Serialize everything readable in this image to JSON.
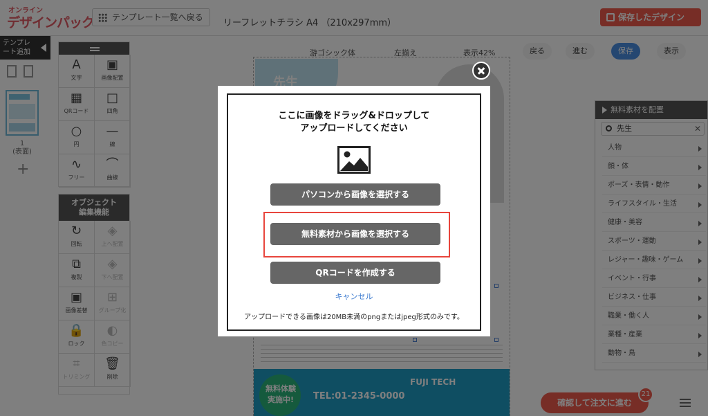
{
  "header": {
    "logo_line1": "オンライン",
    "logo_line2": "デザインパック",
    "template_back": "テンプレート一覧へ戻る",
    "doc_title": "リーフレットチラシ A4 （210x297mm）",
    "save_design": "保存したデザイン"
  },
  "left_panel": {
    "template_add": "テンプレート追加",
    "page_label_line1": "1",
    "page_label_line2": "(表面)",
    "add_page": "+"
  },
  "tools": [
    {
      "label": "文字",
      "glyph": "A",
      "icon": "text-icon"
    },
    {
      "label": "画像配置",
      "glyph": "▣",
      "icon": "image-icon"
    },
    {
      "label": "QRコード",
      "glyph": "▦",
      "icon": "qr-icon"
    },
    {
      "label": "四角",
      "glyph": "□",
      "icon": "square-icon"
    },
    {
      "label": "円",
      "glyph": "○",
      "icon": "circle-icon"
    },
    {
      "label": "線",
      "glyph": "—",
      "icon": "line-icon"
    },
    {
      "label": "フリー",
      "glyph": "∿",
      "icon": "free-draw-icon"
    },
    {
      "label": "曲線",
      "glyph": "⌒",
      "icon": "curve-icon"
    }
  ],
  "edit_panel": {
    "title_line1": "オブジェクト",
    "title_line2": "編集機能",
    "items": [
      {
        "label": "回転",
        "glyph": "↻",
        "dim": false
      },
      {
        "label": "上へ配置",
        "glyph": "◈",
        "dim": true
      },
      {
        "label": "複製",
        "glyph": "⧉",
        "dim": false
      },
      {
        "label": "下へ配置",
        "glyph": "◈",
        "dim": true
      },
      {
        "label": "画像差替",
        "glyph": "▣",
        "dim": false
      },
      {
        "label": "グループ化",
        "glyph": "⊞",
        "dim": true
      },
      {
        "label": "ロック",
        "glyph": "🔒",
        "dim": false
      },
      {
        "label": "色コピー",
        "glyph": "◐",
        "dim": true
      },
      {
        "label": "トリミング",
        "glyph": "⌗",
        "dim": true
      },
      {
        "label": "削除",
        "glyph": "🗑",
        "dim": false
      }
    ]
  },
  "canvas_toolbar": {
    "font_select": "游ゴシック体",
    "align_select": "左揃え",
    "zoom": "表示42%",
    "back_btn": "戻る",
    "forward_btn": "進む",
    "save_btn": "保存",
    "preview_btn": "表示"
  },
  "flyer": {
    "campaign_line1": "無料体験",
    "campaign_line2": "実施中!",
    "phone": "TEL:01-2345-0000",
    "company": "FUJI TECH",
    "heading_char": "先生"
  },
  "right_panel": {
    "title": "無料素材を配置",
    "search_value": "先生",
    "categories": [
      "人物",
      "顔・体",
      "ポーズ・表情・動作",
      "ライフスタイル・生活",
      "健康・美容",
      "スポーツ・運動",
      "レジャー・趣味・ゲーム",
      "イベント・行事",
      "ビジネス・仕事",
      "職業・働く人",
      "業種・産業",
      "動物・鳥"
    ]
  },
  "order": {
    "button": "確認して注文に進む",
    "badge": "21"
  },
  "modal": {
    "title_line1": "ここに画像をドラッグ&ドロップして",
    "title_line2": "アップロードしてください",
    "btn_pc": "パソコンから画像を選択する",
    "btn_free": "無料素材から画像を選択する",
    "btn_qr": "QRコードを作成する",
    "cancel": "キャンセル",
    "note": "アップロードできる画像は20MB未満のpngまたはjpeg形式のみです。"
  },
  "colors": {
    "accent_red": "#ef5b4c",
    "highlight": "#e8453c",
    "link_blue": "#3a79cf",
    "modal_button": "#666666"
  }
}
